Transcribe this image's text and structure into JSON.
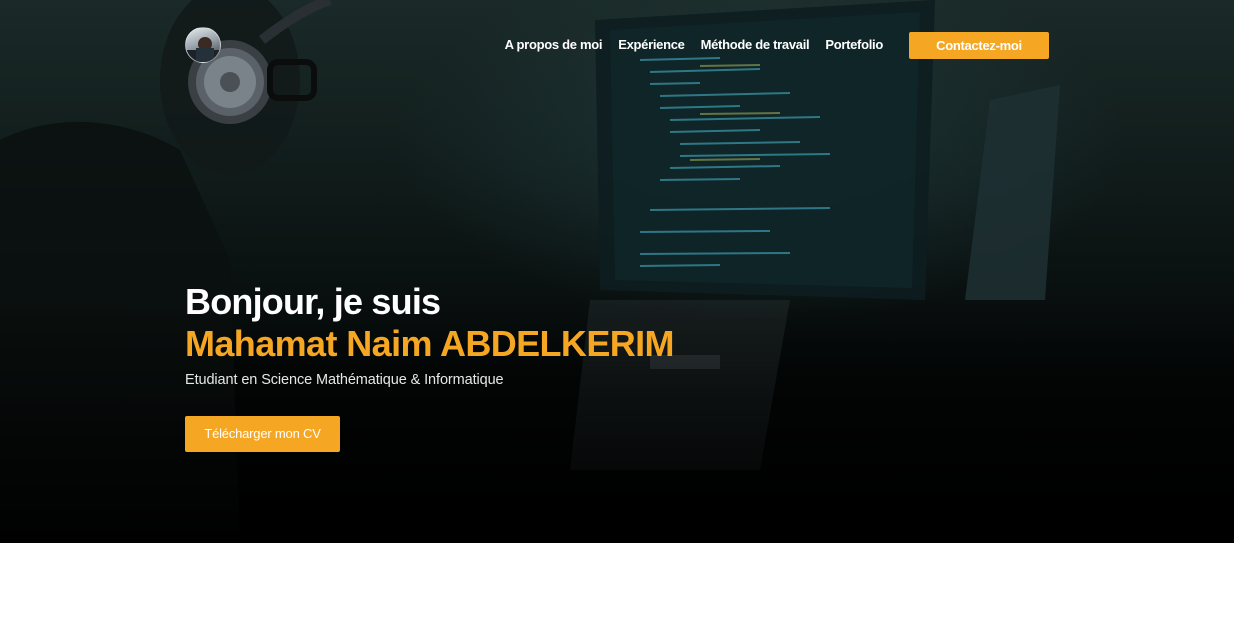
{
  "nav": {
    "avatar_icon": "profile-photo",
    "links": [
      {
        "label": "A propos de moi"
      },
      {
        "label": "Expérience"
      },
      {
        "label": "Méthode de travail"
      },
      {
        "label": "Portefolio"
      }
    ],
    "contact_label": "Contactez-moi"
  },
  "hero": {
    "greeting": "Bonjour, je suis",
    "name": "Mahamat Naim ABDELKERIM",
    "subtitle": "Etudiant en Science Mathématique & Informatique",
    "cv_button_label": "Télécharger mon CV",
    "background_image": "developer-with-headphones-coding"
  },
  "colors": {
    "accent": "#f5a623",
    "hero_dark": "#000000",
    "text_light": "#ffffff"
  }
}
